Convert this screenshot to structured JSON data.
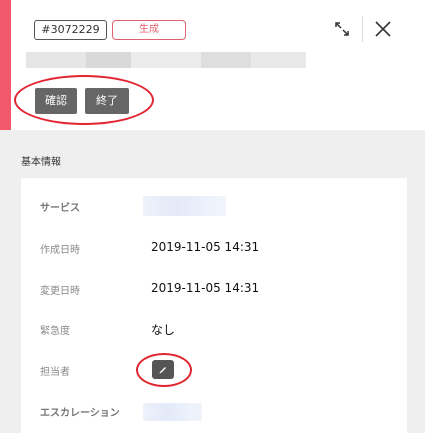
{
  "ticket": {
    "id": "#3072229",
    "status": "生成",
    "status_color": "#e0606e",
    "accent_color": "#f25a6b"
  },
  "header": {
    "expand_icon": "expand-icon",
    "close_icon": "close-icon"
  },
  "actions": {
    "confirm_label": "確認",
    "end_label": "終了"
  },
  "section": {
    "title": "基本情報"
  },
  "fields": {
    "service_label": "サービス",
    "created_label": "作成日時",
    "created_value": "2019-11-05 14:31",
    "updated_label": "変更日時",
    "updated_value": "2019-11-05 14:31",
    "urgency_label": "緊急度",
    "urgency_value": "なし",
    "assignee_label": "担当者",
    "escalation_label": "エスカレーション"
  },
  "annotations": {
    "highlight_color": "#e2242e"
  }
}
